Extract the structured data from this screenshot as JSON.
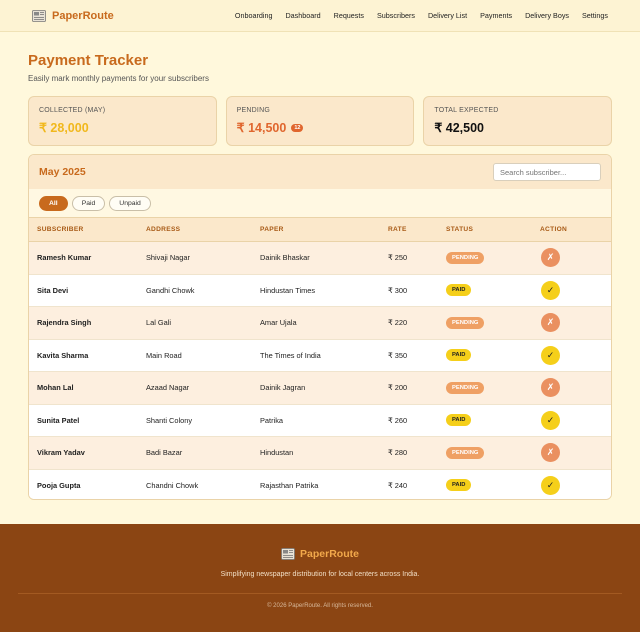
{
  "brand": {
    "name": "PaperRoute",
    "icon": "newspaper-icon"
  },
  "nav": [
    "Onboarding",
    "Dashboard",
    "Requests",
    "Subscribers",
    "Delivery List",
    "Payments",
    "Delivery Boys",
    "Settings"
  ],
  "page": {
    "title": "Payment Tracker",
    "subtitle": "Easily mark monthly payments for your subscribers"
  },
  "cards": {
    "collected": {
      "label": "COLLECTED (MAY)",
      "value": "₹ 28,000"
    },
    "pending": {
      "label": "PENDING",
      "value": "₹ 14,500",
      "count": "12"
    },
    "total": {
      "label": "TOTAL EXPECTED",
      "value": "₹ 42,500"
    }
  },
  "panel": {
    "month": "May 2025",
    "search_placeholder": "Search subscriber..."
  },
  "filters": [
    "All",
    "Paid",
    "Unpaid"
  ],
  "columns": [
    "SUBSCRIBER",
    "ADDRESS",
    "PAPER",
    "RATE",
    "STATUS",
    "ACTION"
  ],
  "rows": [
    {
      "name": "Ramesh Kumar",
      "address": "Shivaji Nagar",
      "paper": "Dainik Bhaskar",
      "rate": "₹ 250",
      "status": "PENDING",
      "action": "✗"
    },
    {
      "name": "Sita Devi",
      "address": "Gandhi Chowk",
      "paper": "Hindustan Times",
      "rate": "₹ 300",
      "status": "PAID",
      "action": "✓"
    },
    {
      "name": "Rajendra Singh",
      "address": "Lal Gali",
      "paper": "Amar Ujala",
      "rate": "₹ 220",
      "status": "PENDING",
      "action": "✗"
    },
    {
      "name": "Kavita Sharma",
      "address": "Main Road",
      "paper": "The Times of India",
      "rate": "₹ 350",
      "status": "PAID",
      "action": "✓"
    },
    {
      "name": "Mohan Lal",
      "address": "Azaad Nagar",
      "paper": "Dainik Jagran",
      "rate": "₹ 200",
      "status": "PENDING",
      "action": "✗"
    },
    {
      "name": "Sunita Patel",
      "address": "Shanti Colony",
      "paper": "Patrika",
      "rate": "₹ 260",
      "status": "PAID",
      "action": "✓"
    },
    {
      "name": "Vikram Yadav",
      "address": "Badi Bazar",
      "paper": "Hindustan",
      "rate": "₹ 280",
      "status": "PENDING",
      "action": "✗"
    },
    {
      "name": "Pooja Gupta",
      "address": "Chandni Chowk",
      "paper": "Rajasthan Patrika",
      "rate": "₹ 240",
      "status": "PAID",
      "action": "✓"
    }
  ],
  "footer": {
    "brand": "PaperRoute",
    "tagline": "Simplifying newspaper distribution for local centers across India.",
    "copyright": "© 2026 PaperRoute. All rights reserved."
  },
  "colors": {
    "accent": "#c86a1d",
    "paid": "#f5cf1a",
    "pending": "#efa064",
    "footer": "#8b4513"
  }
}
